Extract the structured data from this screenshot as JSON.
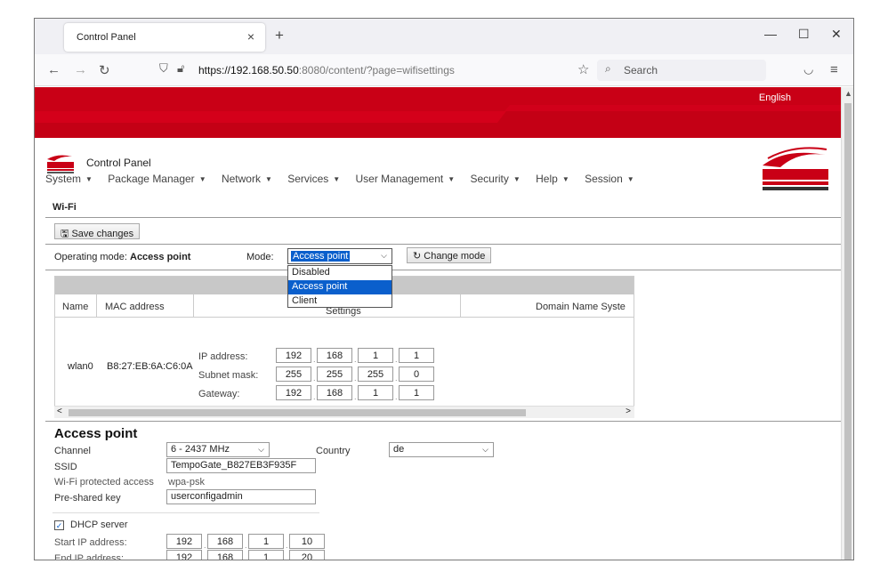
{
  "browser": {
    "tab_title": "Control Panel",
    "tab_close": "×",
    "new_tab": "+",
    "url_host": "https://192.168.50.50",
    "url_rest": ":8080/content/?page=wifisettings",
    "search_placeholder": "Search"
  },
  "header": {
    "language": "English",
    "app_title": "Control Panel",
    "menu": [
      "System",
      "Package Manager",
      "Network",
      "Services",
      "User Management",
      "Security",
      "Help",
      "Session"
    ]
  },
  "wifi": {
    "section_title": "Wi-Fi",
    "save_label": "Save changes",
    "operating_mode_label": "Operating mode:",
    "operating_mode_value": "Access point",
    "mode_label": "Mode:",
    "mode_selected": "Access point",
    "mode_options": [
      "Disabled",
      "Access point",
      "Client"
    ],
    "change_mode_label": "Change mode",
    "table": {
      "columns": [
        "Name",
        "MAC address",
        "Settings",
        "Domain Name Syste"
      ],
      "row": {
        "name": "wlan0",
        "mac": "B8:27:EB:6A:C6:0A",
        "ip_label": "IP address:",
        "ip": [
          "192",
          "168",
          "1",
          "1"
        ],
        "mask_label": "Subnet mask:",
        "mask": [
          "255",
          "255",
          "255",
          "0"
        ],
        "gw_label": "Gateway:",
        "gw": [
          "192",
          "168",
          "1",
          "1"
        ]
      }
    }
  },
  "access_point": {
    "title": "Access point",
    "channel_label": "Channel",
    "channel_value": "6 - 2437 MHz",
    "country_label": "Country",
    "country_value": "de",
    "ssid_label": "SSID",
    "ssid_value": "TempoGate_B827EB3F935F",
    "wpa_label": "Wi-Fi protected access",
    "wpa_value": "wpa-psk",
    "psk_label": "Pre-shared key",
    "psk_value": "userconfigadmin",
    "dhcp_label": "DHCP server",
    "dhcp_checked": true,
    "start_label": "Start IP address:",
    "start_ip": [
      "192",
      "168",
      "1",
      "10"
    ],
    "end_label": "End IP address:",
    "end_ip": [
      "192",
      "168",
      "1",
      "20"
    ]
  }
}
